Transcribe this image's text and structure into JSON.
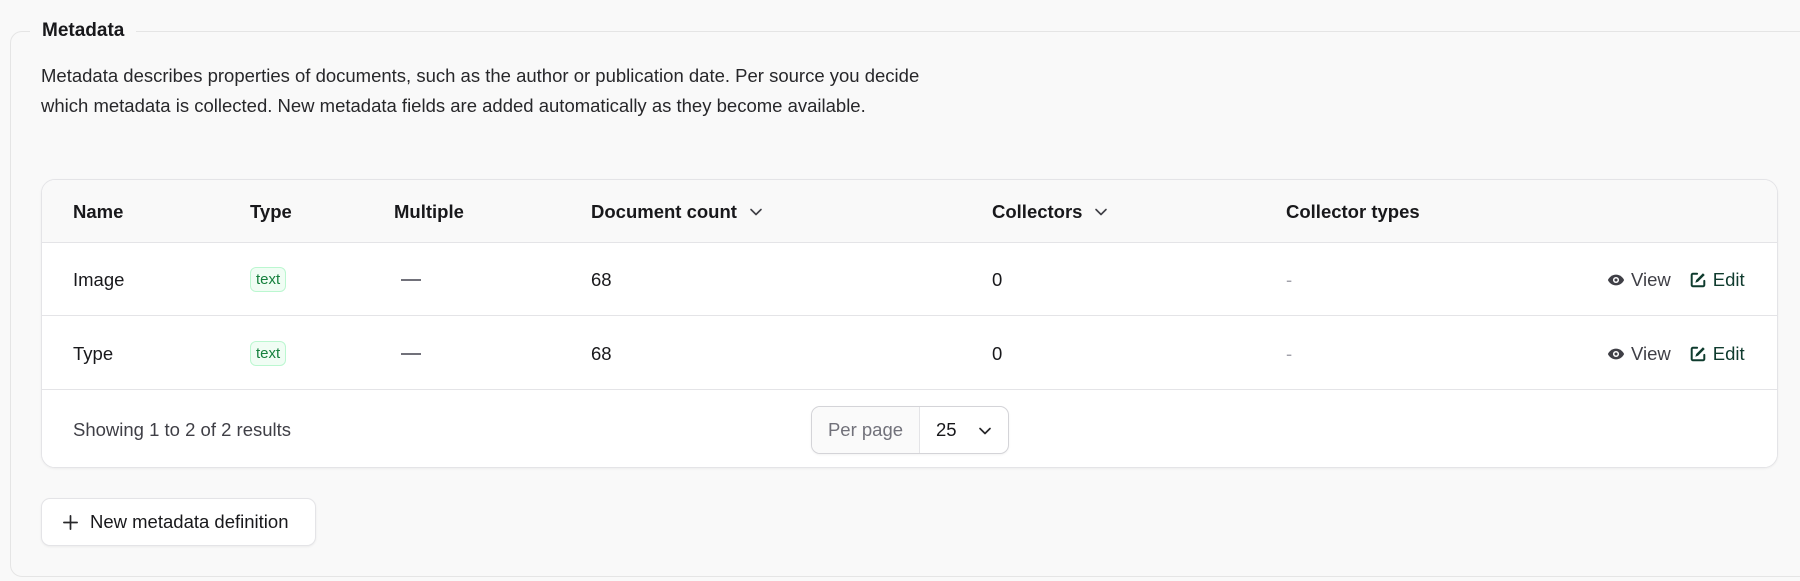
{
  "section": {
    "legend": "Metadata",
    "description": "Metadata describes properties of documents, such as the author or publication date. Per source you decide which metadata is collected. New metadata fields are added automatically as they become available."
  },
  "table": {
    "columns": {
      "name": "Name",
      "type": "Type",
      "multiple": "Multiple",
      "document_count": "Document count",
      "collectors": "Collectors",
      "collector_types": "Collector types"
    },
    "rows": [
      {
        "name": "Image",
        "type": "text",
        "multiple": "—",
        "document_count": "68",
        "collectors": "0",
        "collector_types": "-",
        "view_label": "View",
        "edit_label": "Edit"
      },
      {
        "name": "Type",
        "type": "text",
        "multiple": "—",
        "document_count": "68",
        "collectors": "0",
        "collector_types": "-",
        "view_label": "View",
        "edit_label": "Edit"
      }
    ]
  },
  "pagination": {
    "summary": "Showing 1 to 2 of 2 results",
    "per_page_label": "Per page",
    "per_page_value": "25"
  },
  "new_button": {
    "label": "New metadata definition"
  },
  "icons": {
    "view": "eye-icon",
    "edit": "edit-icon",
    "sort": "chevron-down-icon",
    "add": "plus-icon"
  },
  "colors": {
    "badge_text": "#15803d",
    "badge_bg": "#f0fdf4",
    "edit_action": "#0f3b2e"
  }
}
